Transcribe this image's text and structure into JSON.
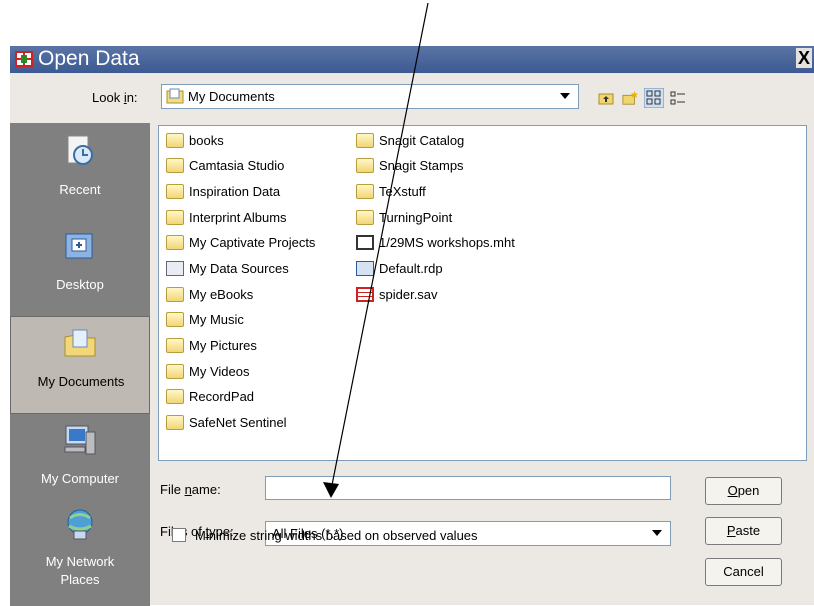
{
  "window": {
    "title": "Open Data",
    "close_glyph": "X"
  },
  "lookin": {
    "label_pre": "Look ",
    "label_u": "i",
    "label_post": "n:",
    "value": "My Documents"
  },
  "places": [
    {
      "label": "Recent",
      "icon": "recent-icon"
    },
    {
      "label": "Desktop",
      "icon": "desktop-icon"
    },
    {
      "label": "My Documents",
      "icon": "my-documents-icon"
    },
    {
      "label": "My Computer",
      "icon": "my-computer-icon"
    },
    {
      "label": "My Network",
      "label2": "Places",
      "icon": "network-icon"
    }
  ],
  "files_col1": [
    "books",
    "Camtasia Studio",
    "Inspiration Data",
    "Interprint Albums",
    "My Captivate Projects",
    "My Data Sources",
    "My eBooks",
    "My Music",
    "My Pictures",
    "My Videos",
    "RecordPad",
    "SafeNet Sentinel"
  ],
  "files_col2": [
    "Snagit Catalog",
    "Snagit Stamps",
    "TeXstuff",
    "TurningPoint",
    "1/29MS workshops.mht",
    "Default.rdp",
    "spider.sav"
  ],
  "filename": {
    "label_pre": "File ",
    "label_u": "n",
    "label_post": "ame:",
    "value": ""
  },
  "filetype": {
    "label_pre": "Files of ",
    "label_u": "t",
    "label_post": "ype:",
    "value": "All Files (*.*)"
  },
  "buttons": {
    "open_u": "O",
    "open_rest": "pen",
    "paste_u": "P",
    "paste_rest": "aste",
    "cancel": "Cancel"
  },
  "minimize_label": "Minimize string widths based on observed values"
}
